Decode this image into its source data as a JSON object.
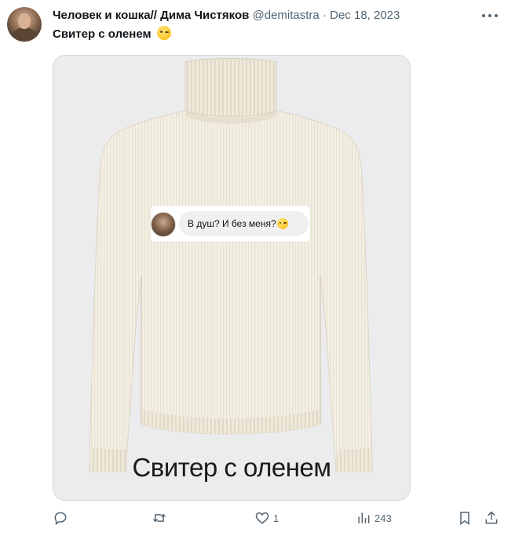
{
  "author": {
    "display_name": "Человек и кошка// Дима Чистяков",
    "handle": "@demitastra",
    "separator": "·",
    "date": "Dec 18, 2023"
  },
  "tweet": {
    "text": "Свитер с оленем",
    "emoji": "wink-emoji"
  },
  "media": {
    "story_reply_text": "В душ? И без меня?",
    "caption": "Свитер с оленем",
    "sweater_color": "#f3efe3",
    "background_color": "#ececef"
  },
  "actions": {
    "reply_icon": "reply-icon",
    "retweet_icon": "retweet-icon",
    "like_icon": "heart-icon",
    "like_count": "1",
    "views_icon": "views-chart-icon",
    "views_count": "243",
    "bookmark_icon": "bookmark-icon",
    "share_icon": "share-icon"
  },
  "colors": {
    "text_primary": "#0f1419",
    "text_secondary": "#536471",
    "border": "#cfd9de"
  }
}
